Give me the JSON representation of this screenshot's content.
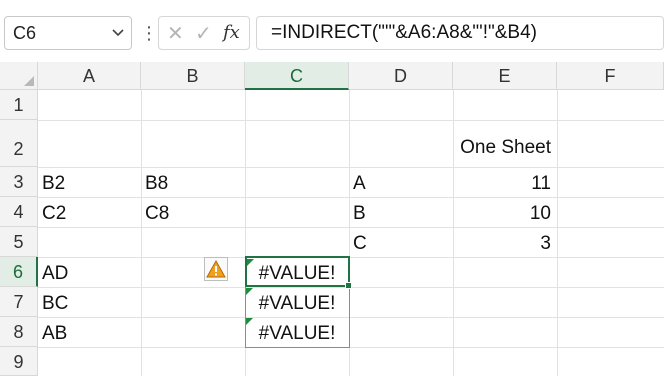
{
  "name_box": {
    "value": "C6"
  },
  "formula_bar": {
    "cancel_glyph": "✕",
    "enter_glyph": "✓",
    "fx_label": "fx",
    "formula": "=INDIRECT(\"'\"&A6:A8&\"'!\"&B4)"
  },
  "columns": [
    "A",
    "B",
    "C",
    "D",
    "E",
    "F"
  ],
  "rows": [
    "1",
    "2",
    "3",
    "4",
    "5",
    "6",
    "7",
    "8",
    "9"
  ],
  "active_cell": "C6",
  "cells": {
    "E2": "One Sheet",
    "A3": "B2",
    "B3": "B8",
    "D3": "A",
    "E3": "11",
    "A4": "C2",
    "B4": "C8",
    "D4": "B",
    "E4": "10",
    "D5": "C",
    "E5": "3",
    "A6": "AD",
    "C6": "#VALUE!",
    "A7": "BC",
    "C7": "#VALUE!",
    "A8": "AB",
    "C8": "#VALUE!"
  },
  "colors": {
    "accent": "#217346",
    "header_bg": "#f3f3f3",
    "grid": "#e2e2e2",
    "warning": "#f0a020"
  }
}
